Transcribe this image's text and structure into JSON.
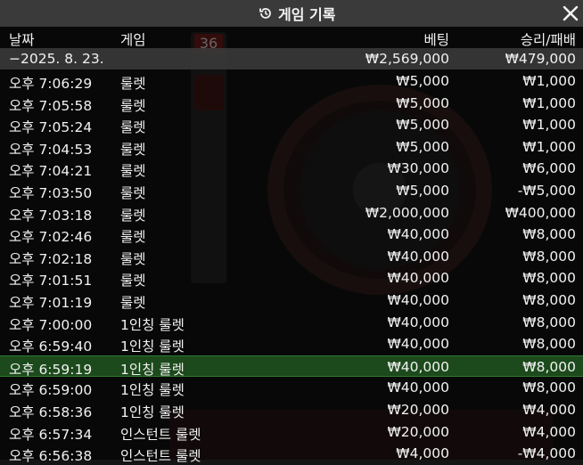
{
  "header": {
    "title": "게임 기록"
  },
  "columns": {
    "date": "날짜",
    "game": "게임",
    "bet": "베팅",
    "result": "승리/패배"
  },
  "summary": {
    "date": "−2025. 8. 23.",
    "bet": "₩2,569,000",
    "result": "₩479,000"
  },
  "rows": [
    {
      "time": "오후 7:06:29",
      "game": "룰렛",
      "bet": "₩5,000",
      "result": "₩1,000"
    },
    {
      "time": "오후 7:05:58",
      "game": "룰렛",
      "bet": "₩5,000",
      "result": "₩1,000"
    },
    {
      "time": "오후 7:05:24",
      "game": "룰렛",
      "bet": "₩5,000",
      "result": "₩1,000"
    },
    {
      "time": "오후 7:04:53",
      "game": "룰렛",
      "bet": "₩5,000",
      "result": "₩1,000"
    },
    {
      "time": "오후 7:04:21",
      "game": "룰렛",
      "bet": "₩30,000",
      "result": "₩6,000"
    },
    {
      "time": "오후 7:03:50",
      "game": "룰렛",
      "bet": "₩5,000",
      "result": "-₩5,000"
    },
    {
      "time": "오후 7:03:18",
      "game": "룰렛",
      "bet": "₩2,000,000",
      "result": "₩400,000"
    },
    {
      "time": "오후 7:02:46",
      "game": "룰렛",
      "bet": "₩40,000",
      "result": "₩8,000"
    },
    {
      "time": "오후 7:02:18",
      "game": "룰렛",
      "bet": "₩40,000",
      "result": "₩8,000"
    },
    {
      "time": "오후 7:01:51",
      "game": "룰렛",
      "bet": "₩40,000",
      "result": "₩8,000"
    },
    {
      "time": "오후 7:01:19",
      "game": "룰렛",
      "bet": "₩40,000",
      "result": "₩8,000"
    },
    {
      "time": "오후 7:00:00",
      "game": "1인칭 룰렛",
      "bet": "₩40,000",
      "result": "₩8,000"
    },
    {
      "time": "오후 6:59:40",
      "game": "1인칭 룰렛",
      "bet": "₩40,000",
      "result": "₩8,000"
    },
    {
      "time": "오후 6:59:19",
      "game": "1인칭 룰렛",
      "bet": "₩40,000",
      "result": "₩8,000"
    },
    {
      "time": "오후 6:59:00",
      "game": "1인칭 룰렛",
      "bet": "₩40,000",
      "result": "₩8,000"
    },
    {
      "time": "오후 6:58:36",
      "game": "1인칭 룰렛",
      "bet": "₩20,000",
      "result": "₩4,000"
    },
    {
      "time": "오후 6:57:34",
      "game": "인스턴트 룰렛",
      "bet": "₩20,000",
      "result": "₩4,000"
    },
    {
      "time": "오후 6:56:38",
      "game": "인스턴트 룰렛",
      "bet": "₩4,000",
      "result": "-₩4,000"
    }
  ],
  "background": {
    "strip_top_number": "36"
  },
  "icons": {
    "history": "history-icon",
    "close": "close-icon"
  },
  "colors": {
    "highlight_row": "#1c4a1c",
    "titlebar": "#3a3a3a"
  }
}
